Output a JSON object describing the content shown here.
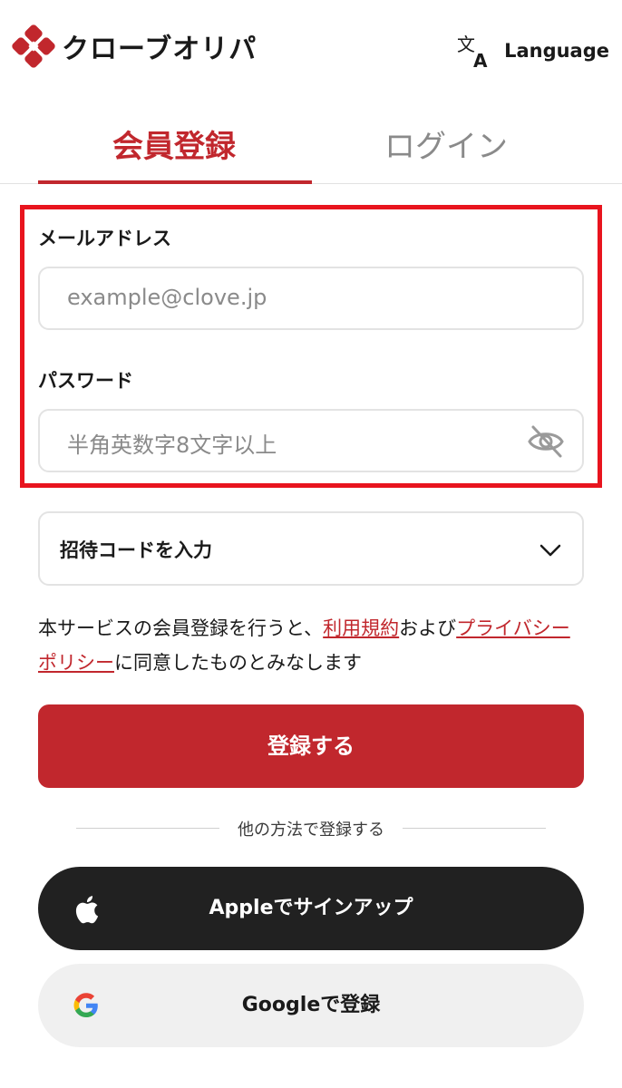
{
  "header": {
    "logo_text": "クローブオリパ",
    "language_label": "Language",
    "icons": {
      "logo": "clover-logo-icon",
      "language": "translate-icon"
    }
  },
  "tabs": [
    {
      "label": "会員登録",
      "active": true
    },
    {
      "label": "ログイン",
      "active": false
    }
  ],
  "form": {
    "email": {
      "label": "メールアドレス",
      "placeholder": "example@clove.jp",
      "value": ""
    },
    "password": {
      "label": "パスワード",
      "placeholder": "半角英数字8文字以上",
      "value": "",
      "visibility_icon": "eye-off-icon"
    },
    "invite_code": {
      "label": "招待コードを入力",
      "icon": "chevron-down-icon"
    }
  },
  "terms": {
    "prefix": "本サービスの会員登録を行うと、",
    "terms_link": "利用規約",
    "middle": "および",
    "privacy_link": "プライバシーポリシー",
    "suffix": "に同意したものとみなします"
  },
  "actions": {
    "register_label": "登録する",
    "divider_text": "他の方法で登録する",
    "apple_label": "Appleでサインアップ",
    "google_label": "Googleで登録"
  },
  "colors": {
    "brand_red": "#c1272d",
    "highlight_red": "#e8141e",
    "apple_button": "#212121",
    "google_button": "#f0f0f0"
  }
}
